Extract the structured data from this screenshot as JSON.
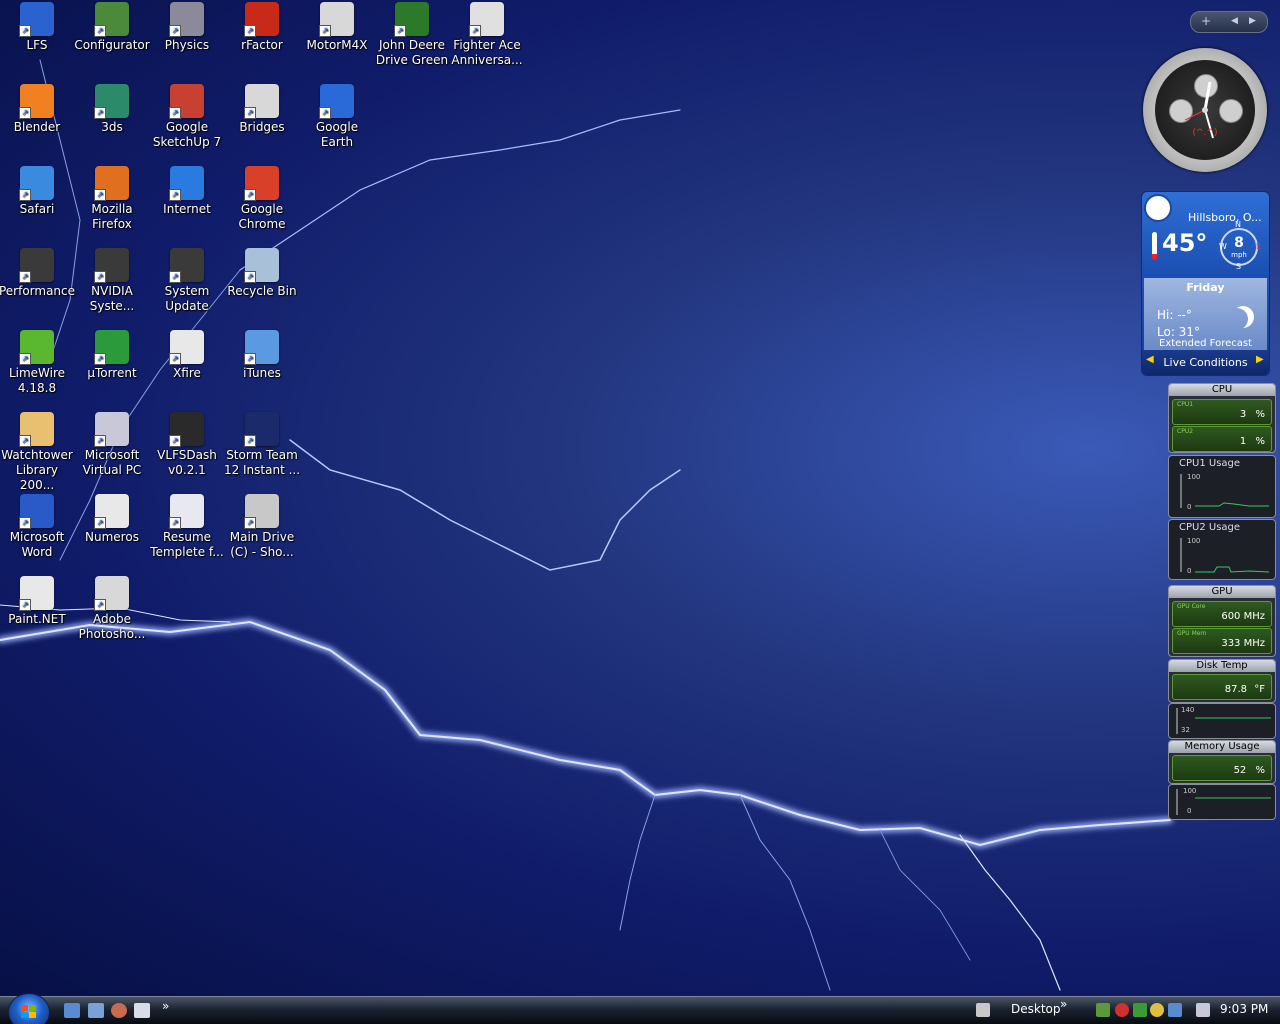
{
  "desktop": {
    "icons": [
      {
        "label": "LFS",
        "icon": "lfs-icon",
        "color": "#2a62d0"
      },
      {
        "label": "Configurator",
        "icon": "configurator-icon",
        "color": "#4a8a3a"
      },
      {
        "label": "Physics",
        "icon": "physics-icon",
        "color": "#8a8a9a"
      },
      {
        "label": "rFactor",
        "icon": "rfactor-icon",
        "color": "#c82a1a"
      },
      {
        "label": "MotorM4X",
        "icon": "motorm4x-icon",
        "color": "#d8d8d8"
      },
      {
        "label": "John Deere Drive Green",
        "icon": "john-deere-icon",
        "color": "#2a7a2a"
      },
      {
        "label": "Fighter Ace Anniversa...",
        "icon": "fighter-ace-icon",
        "color": "#e0e0e0"
      },
      {
        "label": "Blender",
        "icon": "blender-icon",
        "color": "#f08020"
      },
      {
        "label": "3ds",
        "icon": "3ds-icon",
        "color": "#2a8a6a"
      },
      {
        "label": "Google SketchUp 7",
        "icon": "sketchup-icon",
        "color": "#c84030"
      },
      {
        "label": "Bridges",
        "icon": "bridges-icon",
        "color": "#d8d8d8"
      },
      {
        "label": "Google Earth",
        "icon": "google-earth-icon",
        "color": "#2a6ad8"
      },
      {
        "label": "Safari",
        "icon": "safari-icon",
        "color": "#3a8ae0"
      },
      {
        "label": "Mozilla Firefox",
        "icon": "firefox-icon",
        "color": "#e07020"
      },
      {
        "label": "Internet",
        "icon": "internet-explorer-icon",
        "color": "#2a7ae0"
      },
      {
        "label": "Google Chrome",
        "icon": "chrome-icon",
        "color": "#d8402a"
      },
      {
        "label": "Performance",
        "icon": "nvidia-performance-icon",
        "color": "#3a3a3a"
      },
      {
        "label": "NVIDIA Syste...",
        "icon": "nvidia-system-icon",
        "color": "#3a3a3a"
      },
      {
        "label": "System Update",
        "icon": "nvidia-update-icon",
        "color": "#3a3a3a"
      },
      {
        "label": "Recycle Bin",
        "icon": "recycle-bin-icon",
        "color": "#a8c0d8"
      },
      {
        "label": "LimeWire 4.18.8",
        "icon": "limewire-icon",
        "color": "#5ab830"
      },
      {
        "label": "µTorrent",
        "icon": "utorrent-icon",
        "color": "#2a9a3a"
      },
      {
        "label": "Xfire",
        "icon": "xfire-icon",
        "color": "#e8e8e8"
      },
      {
        "label": "iTunes",
        "icon": "itunes-icon",
        "color": "#5a9ae0"
      },
      {
        "label": "Watchtower Library 200...",
        "icon": "watchtower-icon",
        "color": "#e8c070"
      },
      {
        "label": "Microsoft Virtual PC",
        "icon": "virtual-pc-icon",
        "color": "#c8c8d8"
      },
      {
        "label": "VLFSDash v0.2.1",
        "icon": "vlfsdash-icon",
        "color": "#2a2a2a"
      },
      {
        "label": "Storm Team 12 Instant ...",
        "icon": "storm-team-icon",
        "color": "#1a2a6a"
      },
      {
        "label": "Microsoft Word",
        "icon": "word-icon",
        "color": "#2a5ac8"
      },
      {
        "label": "Numeros",
        "icon": "numbers-icon",
        "color": "#e8e8e8"
      },
      {
        "label": "Resume Templete f...",
        "icon": "word-document-icon",
        "color": "#e8e8f0"
      },
      {
        "label": "Main Drive (C) - Sho...",
        "icon": "drive-icon",
        "color": "#c8c8c8"
      },
      {
        "label": "Paint.NET",
        "icon": "paintnet-icon",
        "color": "#e8e8e8"
      },
      {
        "label": "Adobe Photosho...",
        "icon": "photoshop-icon",
        "color": "#d8d8d8"
      }
    ]
  },
  "sidebar": {
    "add_glyph": "+",
    "prev_glyph": "◀",
    "next_glyph": "▶"
  },
  "clock": {
    "brand": "(^.^)"
  },
  "weather": {
    "location": "Hillsboro, O...",
    "temperature": "45°",
    "wind_speed": "8",
    "wind_unit": "mph",
    "compass_n": "N",
    "compass_s": "S",
    "compass_w": "W",
    "compass_e": "E",
    "day": "Friday",
    "hi": "Hi: --°",
    "lo": "Lo: 31°",
    "extended": "Extended Forecast",
    "live": "Live Conditions"
  },
  "cpu_meter": {
    "title": "CPU",
    "cpu1_label": "CPU1",
    "cpu1_value": "3",
    "cpu1_unit": "%",
    "cpu2_label": "CPU2",
    "cpu2_value": "1",
    "cpu2_unit": "%"
  },
  "cpu1_graph": {
    "title": "CPU1 Usage",
    "max": "100",
    "min": "0"
  },
  "cpu2_graph": {
    "title": "CPU2 Usage",
    "max": "100",
    "min": "0"
  },
  "gpu_meter": {
    "title": "GPU",
    "core_label": "GPU Core",
    "core_value": "600 MHz",
    "mem_label": "GPU Mem",
    "mem_value": "333 MHz"
  },
  "disk_temp": {
    "title": "Disk Temp",
    "value": "87.8",
    "unit": "°F",
    "max": "140",
    "min": "32"
  },
  "memory": {
    "title": "Memory Usage",
    "value": "52",
    "unit": "%",
    "max": "100",
    "min": "0"
  },
  "taskbar": {
    "desktop_label": "Desktop",
    "overflow_glyph": "»",
    "time": "9:03 PM"
  }
}
